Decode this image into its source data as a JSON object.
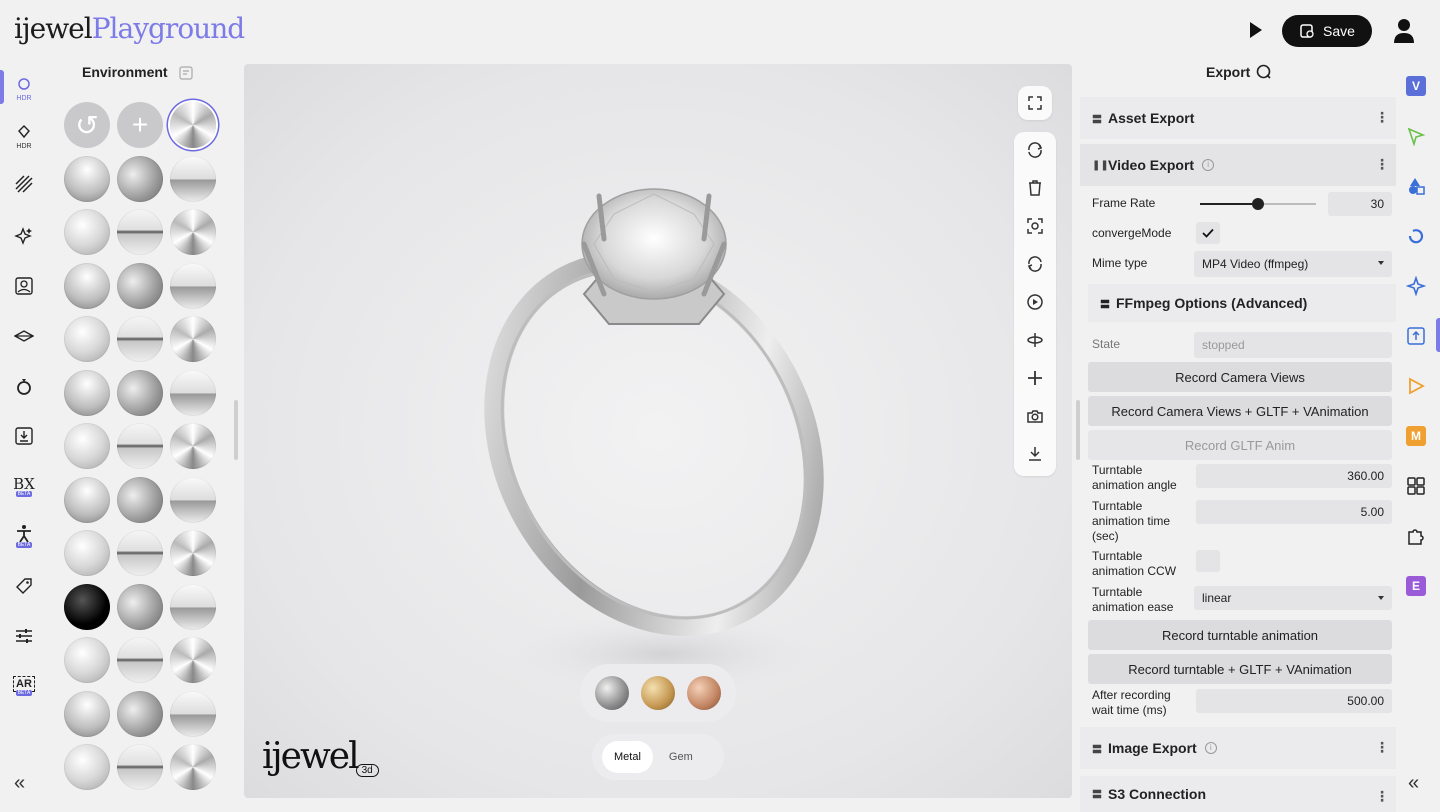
{
  "brand": {
    "logo_main": "ijewel",
    "logo_accent": "Playground",
    "watermark": "ijewel",
    "watermark_badge": "3d"
  },
  "header": {
    "save_label": "Save"
  },
  "left_rail": {
    "items": [
      {
        "icon": "hdr-icon",
        "caption": "HDR"
      },
      {
        "icon": "hdr-diamond-icon",
        "caption": "HDR"
      },
      {
        "icon": "hatch-icon",
        "caption": ""
      },
      {
        "icon": "sparkle-icon",
        "caption": ""
      },
      {
        "icon": "image-frame-icon",
        "caption": ""
      },
      {
        "icon": "ground-plane-icon",
        "caption": ""
      },
      {
        "icon": "ring-icon",
        "caption": ""
      },
      {
        "icon": "export-icon",
        "caption": ""
      },
      {
        "icon": "bx-icon",
        "caption": "BX",
        "badge": "BETA"
      },
      {
        "icon": "figure-icon",
        "caption": "",
        "badge": "BETA"
      },
      {
        "icon": "tag-icon",
        "caption": ""
      },
      {
        "icon": "sliders-icon",
        "caption": ""
      },
      {
        "icon": "ar-icon",
        "caption": "AR",
        "badge": "BETA"
      }
    ],
    "collapse_glyph": "«"
  },
  "environment": {
    "title": "Environment",
    "actions": {
      "reset": "↺",
      "add": "+"
    }
  },
  "viewport": {
    "materials": {
      "metal_label": "Metal",
      "gem_label": "Gem"
    }
  },
  "export_panel": {
    "title": "Export",
    "sections": {
      "asset_export": "Asset Export",
      "video_export": "Video Export",
      "image_export": "Image Export",
      "s3_connection": "S3 Connection"
    },
    "video": {
      "frame_rate_label": "Frame Rate",
      "frame_rate_value": "30",
      "frame_rate_fraction": 0.5,
      "converge_mode_label": "convergeMode",
      "converge_mode_checked": true,
      "mime_type_label": "Mime type",
      "mime_type_value": "MP4 Video (ffmpeg)",
      "ffmpeg_options_label": "FFmpeg Options (Advanced)",
      "state_label": "State",
      "state_value": "stopped",
      "record_camera_views": "Record Camera Views",
      "record_camera_views_gltf": "Record Camera Views + GLTF + VAnimation",
      "record_gltf_anim": "Record GLTF Anim",
      "turntable_angle_label": "Turntable animation angle",
      "turntable_angle_value": "360.00",
      "turntable_time_label": "Turntable animation time (sec)",
      "turntable_time_value": "5.00",
      "turntable_ccw_label": "Turntable animation CCW",
      "turntable_ccw_checked": false,
      "turntable_ease_label": "Turntable animation ease",
      "turntable_ease_value": "linear",
      "record_turntable": "Record turntable animation",
      "record_turntable_gltf": "Record turntable + GLTF + VAnimation",
      "after_recording_label": "After recording wait time (ms)",
      "after_recording_value": "500.00"
    },
    "collapse_glyph": "«"
  },
  "right_rail": {
    "apps": [
      {
        "icon": "v-app-icon",
        "letter": "V",
        "color": "#5a6fd8"
      },
      {
        "icon": "cursor-arrow-icon",
        "letter": "",
        "color": "#6cc04a"
      },
      {
        "icon": "shapes-icon",
        "letter": "",
        "color": "#3b6fd8"
      },
      {
        "icon": "circle-refresh-icon",
        "letter": "",
        "color": "#3b6fd8"
      },
      {
        "icon": "sparkle-app-icon",
        "letter": "",
        "color": "#3b6fd8"
      },
      {
        "icon": "upload-app-icon",
        "letter": "",
        "color": "#3b6fd8"
      },
      {
        "icon": "play-app-icon",
        "letter": "",
        "color": "#f0a030"
      },
      {
        "icon": "m-app-icon",
        "letter": "M",
        "color": "#f0a030"
      },
      {
        "icon": "grid-app-icon",
        "letter": "",
        "color": "#222222"
      },
      {
        "icon": "puzzle-icon",
        "letter": "",
        "color": "#222222"
      },
      {
        "icon": "e-app-icon",
        "letter": "E",
        "color": "#9a5bd8"
      }
    ]
  },
  "colors": {
    "accent": "#7d7be8",
    "dark": "#111111"
  }
}
